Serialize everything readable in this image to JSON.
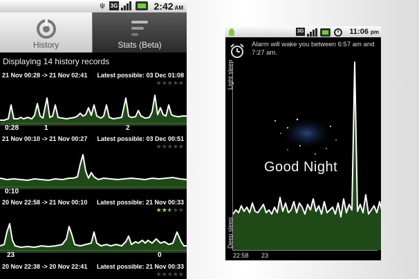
{
  "left_phone": {
    "status_bar": {
      "time": "2:42",
      "ampm": "AM",
      "network": "3G"
    },
    "tabs": [
      {
        "label": "History",
        "active": true
      },
      {
        "label": "Stats (Beta)",
        "active": false
      }
    ],
    "displaying_text": "Displaying 14 history records",
    "records": [
      {
        "range": "21 Nov 00:28 -> 21 Nov 02:41",
        "latest": "Latest possible: 03 Dec 01:08",
        "rating": 0,
        "ticks": [
          "0:28",
          "1",
          "2"
        ]
      },
      {
        "range": "21 Nov 00:10 -> 21 Nov 00:27",
        "latest": "Latest possible: 03 Dec 00:51",
        "rating": 0,
        "ticks": [
          "0:10"
        ]
      },
      {
        "range": "20 Nov 22:58 -> 21 Nov 00:10",
        "latest": "Latest possible: 21 Nov 00:33",
        "rating": 2.5,
        "ticks": [
          "23",
          "0"
        ]
      },
      {
        "range": "20 Nov 22:38 -> 20 Nov 22:41",
        "latest": "Latest possible: 21 Nov 00:33",
        "rating": 0,
        "ticks": []
      }
    ]
  },
  "right_phone": {
    "status_bar": {
      "time": "11:06",
      "ampm": "pm",
      "network": "3G"
    },
    "alarm_text": "Alarm will wake you between 6:57 am and 7:27 am.",
    "y_axis": {
      "top_label": "Light sleep",
      "bottom_label": "Deep sleep"
    },
    "good_night_text": "Good Night",
    "x_ticks": [
      "22:58",
      "23"
    ]
  },
  "colors": {
    "graph_line": "#ffffff",
    "graph_fill": "#1f4a17",
    "star_on": "#9be34f",
    "star_off": "#4a4a4a"
  }
}
